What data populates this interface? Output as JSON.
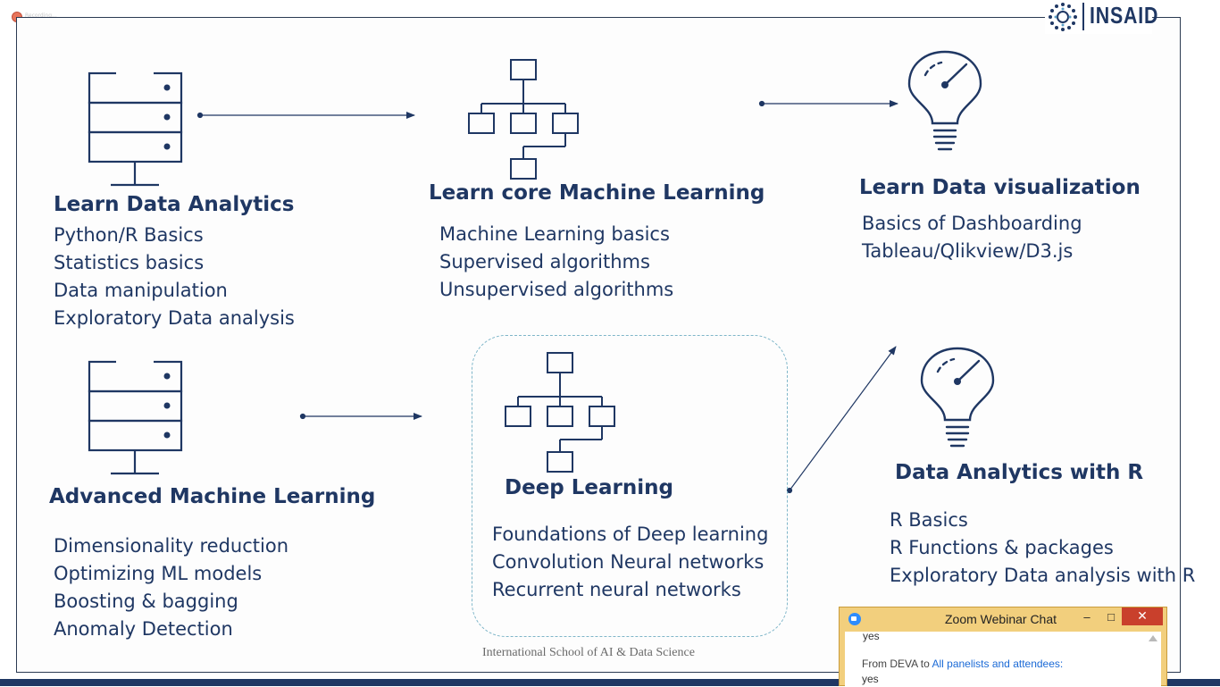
{
  "brand": {
    "logo_text": "INSAID"
  },
  "recording": {
    "label": "Recording..."
  },
  "sections": {
    "data_analytics": {
      "title": "Learn Data Analytics",
      "items": [
        "Python/R Basics",
        "Statistics basics",
        "Data manipulation",
        "Exploratory Data analysis"
      ]
    },
    "core_ml": {
      "title": "Learn core Machine Learning",
      "items": [
        "Machine Learning basics",
        "Supervised algorithms",
        "Unsupervised algorithms"
      ]
    },
    "data_viz": {
      "title": "Learn Data visualization",
      "items": [
        "Basics of Dashboarding",
        "Tableau/Qlikview/D3.js"
      ]
    },
    "advanced_ml": {
      "title": "Advanced Machine Learning",
      "items": [
        "Dimensionality reduction",
        "Optimizing ML models",
        "Boosting & bagging",
        "Anomaly Detection"
      ]
    },
    "deep_learning": {
      "title": "Deep Learning",
      "items": [
        "Foundations of Deep learning",
        "Convolution Neural networks",
        "Recurrent neural networks"
      ]
    },
    "analytics_r": {
      "title": "Data Analytics with R",
      "items": [
        "R Basics",
        "R Functions & packages",
        "Exploratory Data analysis with R"
      ]
    }
  },
  "footer": "International School of AI & Data Science",
  "colors": {
    "navy": "#1f3763",
    "dashed_box": "#7fb6c9",
    "chat_bar": "#f2cf7d",
    "close_red": "#c9402c"
  },
  "chat": {
    "title": "Zoom Webinar Chat",
    "minimize_icon": "minimize-icon",
    "maximize_icon": "maximize-icon",
    "close_icon": "close-icon",
    "message_prev": "yes",
    "from_prefix": "From DEVA to ",
    "from_to": "All panelists and attendees:",
    "message": "yes"
  }
}
